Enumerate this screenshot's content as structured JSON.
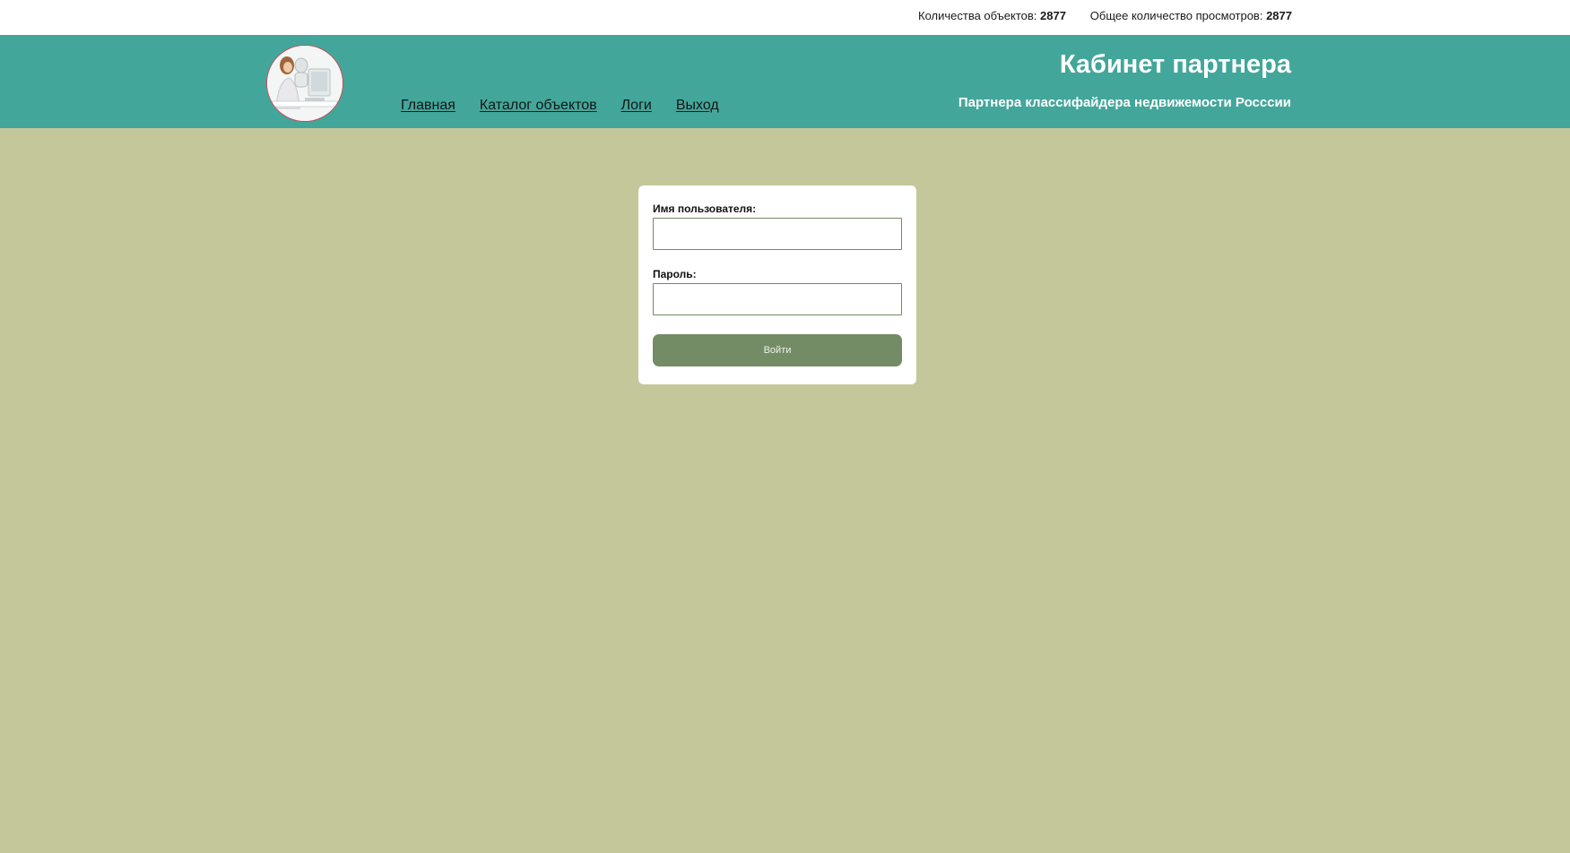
{
  "topbar": {
    "objects_label": "Количества объектов:",
    "objects_count": "2877",
    "views_label": "Общее количество просмотров:",
    "views_count": "2877"
  },
  "header": {
    "title": "Кабинет партнера",
    "subtitle": "Партнера классифайдера недвижемости Росссии",
    "logo_icon": "partner-logo-woman-robot-icon"
  },
  "nav": {
    "items": [
      {
        "label": "Главная"
      },
      {
        "label": "Каталог объектов"
      },
      {
        "label": "Логи"
      },
      {
        "label": "Выход"
      }
    ]
  },
  "login": {
    "username_label": "Имя пользователя:",
    "username_value": "",
    "password_label": "Пароль:",
    "password_value": "",
    "submit_label": "Войти"
  },
  "colors": {
    "page_background": "#c4c79a",
    "header_background": "#43a69a",
    "button_background": "#748c66",
    "input_border": "#6f8a63"
  }
}
